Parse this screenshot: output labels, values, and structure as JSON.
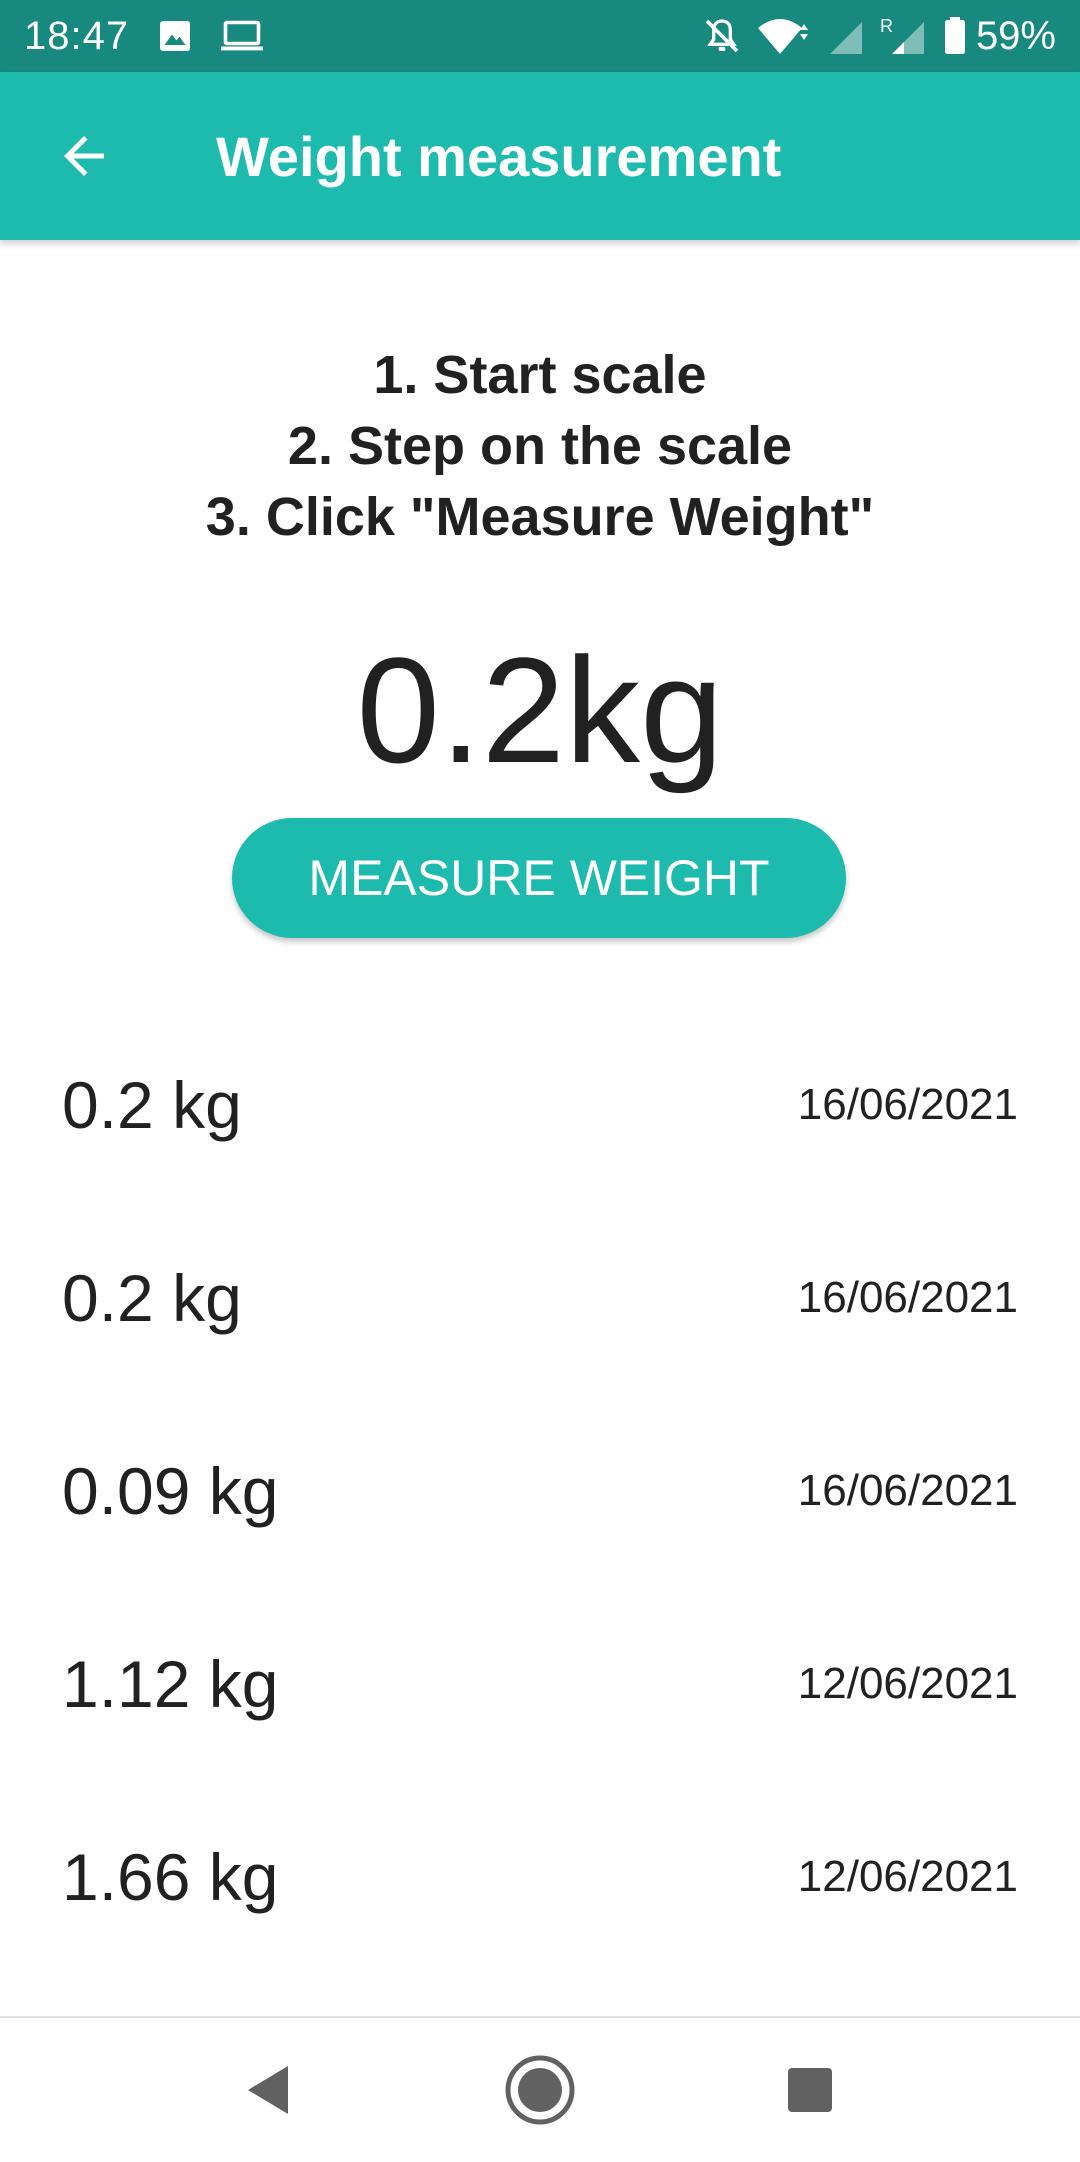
{
  "status_bar": {
    "time": "18:47",
    "battery": "59%",
    "left_icons": [
      "image-icon",
      "laptop-icon"
    ],
    "right_icons": [
      "notifications-off-icon",
      "wifi-icon",
      "signal-icon",
      "roaming-signal-icon",
      "battery-icon"
    ]
  },
  "app_bar": {
    "title": "Weight measurement",
    "back_icon": "arrow-back-icon",
    "color": "#1dbaae"
  },
  "instructions": {
    "step1": "1. Start scale",
    "step2": "2. Step on the scale",
    "step3": "3. Click \"Measure Weight\""
  },
  "current_weight": "0.2kg",
  "measure_button": {
    "label": "MEASURE WEIGHT"
  },
  "history": [
    {
      "weight": "0.2 kg",
      "date": "16/06/2021"
    },
    {
      "weight": "0.2 kg",
      "date": "16/06/2021"
    },
    {
      "weight": "0.09 kg",
      "date": "16/06/2021"
    },
    {
      "weight": "1.12 kg",
      "date": "12/06/2021"
    },
    {
      "weight": "1.66 kg",
      "date": "12/06/2021"
    }
  ],
  "nav_bar": {
    "icons": [
      "back-triangle-icon",
      "home-circle-icon",
      "recents-square-icon"
    ]
  },
  "colors": {
    "status_bar": "#17897f",
    "accent": "#1dbaae",
    "text": "#212121"
  }
}
